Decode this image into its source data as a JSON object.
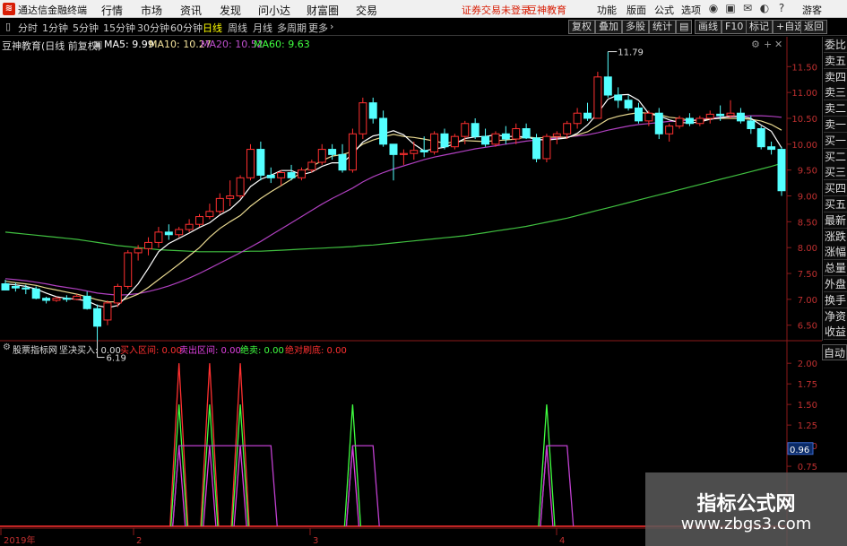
{
  "app": {
    "title": "通达信金融终端",
    "menus": [
      "行情",
      "市场",
      "资讯",
      "发现",
      "问小达",
      "财富圈",
      "交易"
    ],
    "notice": "证券交易未登录",
    "broker": "豆神教育",
    "right_menus": [
      "功能",
      "版面",
      "公式",
      "选项"
    ],
    "guest": "游客"
  },
  "toolbar": {
    "periods": [
      "分时",
      "1分钟",
      "5分钟",
      "15分钟",
      "30分钟",
      "60分钟",
      "日线",
      "周线",
      "月线",
      "多周期",
      "更多"
    ],
    "active_period": "日线",
    "right_buttons": [
      "复权",
      "叠加",
      "多股",
      "统计",
      "画线",
      "F10",
      "标记",
      "+自选",
      "返回"
    ]
  },
  "main_chart": {
    "label": "豆神教育(日线 前复权)",
    "ma": [
      {
        "label": "MA5: 9.99",
        "color": "#ffffff"
      },
      {
        "label": "MA10: 10.27",
        "color": "#f5e49c"
      },
      {
        "label": "MA20: 10.52",
        "color": "#c050d0"
      },
      {
        "label": "MA60: 9.63",
        "color": "#40ff40"
      }
    ],
    "high_label": "11.79",
    "low_label": "6.19"
  },
  "side_tabs": [
    "委比",
    "卖五",
    "卖四",
    "卖三",
    "卖二",
    "卖一",
    "买一",
    "买二",
    "买三",
    "买四",
    "买五",
    "最新",
    "涨跌",
    "涨幅",
    "总量",
    "外盘",
    "换手",
    "净资",
    "收益"
  ],
  "auto_tab": "自动",
  "indicator": {
    "name": "股票指标网",
    "items": [
      {
        "label": "坚决买入: 0.00",
        "color": "#dddddd"
      },
      {
        "label": "买入区间: 0.00",
        "color": "#ff3030"
      },
      {
        "label": "卖出区间: 0.00",
        "color": "#e040e0"
      },
      {
        "label": "绝卖: 0.00",
        "color": "#40ff40"
      },
      {
        "label": "绝对刷底: 0.00",
        "color": "#ff3030"
      }
    ],
    "current_value": "0.96"
  },
  "watermark": {
    "line1": "指标公式网",
    "line2": "www.zbgs3.com"
  },
  "chart_data": {
    "type": "candlestick",
    "y_ticks": [
      "11.50",
      "11.00",
      "10.50",
      "10.00",
      "9.50",
      "9.00",
      "8.50",
      "8.00",
      "7.50",
      "7.00",
      "6.50"
    ],
    "ylim": [
      6.2,
      11.8
    ],
    "indicator_ticks": [
      "2.00",
      "1.75",
      "1.50",
      "1.25",
      "1.00",
      "0.75"
    ],
    "x_labels": [
      "2019年",
      "2",
      "3",
      "4"
    ],
    "candles": [
      [
        7.3,
        7.38,
        7.2,
        7.18
      ],
      [
        7.25,
        7.32,
        7.15,
        7.22
      ],
      [
        7.22,
        7.28,
        7.1,
        7.2
      ],
      [
        7.2,
        7.25,
        7.0,
        7.02
      ],
      [
        7.02,
        7.05,
        6.92,
        6.98
      ],
      [
        6.98,
        7.05,
        6.95,
        7.02
      ],
      [
        7.02,
        7.08,
        6.95,
        7.0
      ],
      [
        7.0,
        7.1,
        6.98,
        7.06
      ],
      [
        7.06,
        7.15,
        6.8,
        6.82
      ],
      [
        6.82,
        6.9,
        6.19,
        6.48
      ],
      [
        6.6,
        6.98,
        6.5,
        6.93
      ],
      [
        6.93,
        7.3,
        6.85,
        7.25
      ],
      [
        7.25,
        7.95,
        7.2,
        7.9
      ],
      [
        7.9,
        8.05,
        7.75,
        7.98
      ],
      [
        7.98,
        8.2,
        7.85,
        8.1
      ],
      [
        8.1,
        8.4,
        8.0,
        8.3
      ],
      [
        8.3,
        8.45,
        8.15,
        8.25
      ],
      [
        8.25,
        8.4,
        8.2,
        8.35
      ],
      [
        8.35,
        8.55,
        8.3,
        8.45
      ],
      [
        8.45,
        8.65,
        8.4,
        8.6
      ],
      [
        8.6,
        8.85,
        8.55,
        8.7
      ],
      [
        8.7,
        9.05,
        8.65,
        8.95
      ],
      [
        8.95,
        9.3,
        8.8,
        9.0
      ],
      [
        9.0,
        9.4,
        8.95,
        9.35
      ],
      [
        9.35,
        10.0,
        9.3,
        9.9
      ],
      [
        9.9,
        10.05,
        9.3,
        9.4
      ],
      [
        9.4,
        9.55,
        9.25,
        9.35
      ],
      [
        9.35,
        9.5,
        9.2,
        9.45
      ],
      [
        9.45,
        9.6,
        9.3,
        9.35
      ],
      [
        9.35,
        9.55,
        9.3,
        9.5
      ],
      [
        9.5,
        9.7,
        9.45,
        9.65
      ],
      [
        9.65,
        10.0,
        9.6,
        9.9
      ],
      [
        9.9,
        10.0,
        9.7,
        9.8
      ],
      [
        9.8,
        10.0,
        9.45,
        9.5
      ],
      [
        9.5,
        10.3,
        9.45,
        10.2
      ],
      [
        10.2,
        10.9,
        10.1,
        10.8
      ],
      [
        10.8,
        10.9,
        10.4,
        10.5
      ],
      [
        10.5,
        10.65,
        9.95,
        10.0
      ],
      [
        10.0,
        10.0,
        9.3,
        9.8
      ],
      [
        9.8,
        9.9,
        9.6,
        9.82
      ],
      [
        9.82,
        10.05,
        9.7,
        9.88
      ],
      [
        9.88,
        10.15,
        9.75,
        9.85
      ],
      [
        9.85,
        10.25,
        9.8,
        10.2
      ],
      [
        10.2,
        10.3,
        9.9,
        9.95
      ],
      [
        9.95,
        10.2,
        9.9,
        10.15
      ],
      [
        10.15,
        10.45,
        10.0,
        10.4
      ],
      [
        10.4,
        10.5,
        10.1,
        10.15
      ],
      [
        10.15,
        10.3,
        9.95,
        10.0
      ],
      [
        10.0,
        10.25,
        9.95,
        10.2
      ],
      [
        10.2,
        10.35,
        10.0,
        10.1
      ],
      [
        10.1,
        10.4,
        10.0,
        10.3
      ],
      [
        10.3,
        10.4,
        10.1,
        10.12
      ],
      [
        10.12,
        10.2,
        9.65,
        9.72
      ],
      [
        9.72,
        10.2,
        9.65,
        10.15
      ],
      [
        10.15,
        10.25,
        10.0,
        10.2
      ],
      [
        10.2,
        10.45,
        10.1,
        10.4
      ],
      [
        10.4,
        10.7,
        10.3,
        10.6
      ],
      [
        10.6,
        10.8,
        10.45,
        10.5
      ],
      [
        10.5,
        11.4,
        10.5,
        11.3
      ],
      [
        11.3,
        11.79,
        10.9,
        10.95
      ],
      [
        10.95,
        11.1,
        10.7,
        10.85
      ],
      [
        10.85,
        10.95,
        10.65,
        10.7
      ],
      [
        10.7,
        10.8,
        10.4,
        10.45
      ],
      [
        10.45,
        10.65,
        10.35,
        10.6
      ],
      [
        10.6,
        10.7,
        10.1,
        10.2
      ],
      [
        10.2,
        10.4,
        10.05,
        10.35
      ],
      [
        10.35,
        10.55,
        10.3,
        10.5
      ],
      [
        10.5,
        10.6,
        10.35,
        10.4
      ],
      [
        10.4,
        10.55,
        10.35,
        10.5
      ],
      [
        10.5,
        10.65,
        10.4,
        10.58
      ],
      [
        10.58,
        10.75,
        10.45,
        10.55
      ],
      [
        10.55,
        10.85,
        10.5,
        10.6
      ],
      [
        10.6,
        10.7,
        10.4,
        10.45
      ],
      [
        10.45,
        10.55,
        10.2,
        10.3
      ],
      [
        10.3,
        10.35,
        9.9,
        9.95
      ],
      [
        9.95,
        10.05,
        9.8,
        9.9
      ],
      [
        9.9,
        9.95,
        9.0,
        9.1
      ]
    ],
    "ma5": [
      7.3,
      7.28,
      7.25,
      7.2,
      7.12,
      7.05,
      7.02,
      7.0,
      6.97,
      6.88,
      6.84,
      6.88,
      7.08,
      7.3,
      7.6,
      7.92,
      8.08,
      8.18,
      8.28,
      8.39,
      8.48,
      8.63,
      8.74,
      8.92,
      9.18,
      9.32,
      9.4,
      9.49,
      9.49,
      9.41,
      9.46,
      9.57,
      9.64,
      9.64,
      9.81,
      10.04,
      10.16,
      10.2,
      10.26,
      10.18,
      10.0,
      9.87,
      9.91,
      9.94,
      10.01,
      10.11,
      10.14,
      10.15,
      10.18,
      10.15,
      10.15,
      10.14,
      10.09,
      10.08,
      10.1,
      10.12,
      10.21,
      10.37,
      10.6,
      10.87,
      10.95,
      10.96,
      10.85,
      10.59,
      10.55,
      10.47,
      10.42,
      10.41,
      10.43,
      10.48,
      10.51,
      10.54,
      10.54,
      10.5,
      10.37,
      10.25,
      9.93
    ],
    "ma10": [
      7.35,
      7.32,
      7.3,
      7.27,
      7.22,
      7.18,
      7.14,
      7.1,
      7.05,
      6.99,
      6.95,
      6.95,
      7.02,
      7.1,
      7.23,
      7.38,
      7.53,
      7.68,
      7.84,
      8.0,
      8.2,
      8.37,
      8.5,
      8.62,
      8.8,
      8.95,
      9.08,
      9.2,
      9.32,
      9.46,
      9.57,
      9.68,
      9.77,
      9.8,
      9.86,
      10.0,
      10.08,
      10.14,
      10.19,
      10.15,
      10.13,
      10.1,
      10.06,
      10.02,
      10.04,
      10.07,
      10.06,
      10.05,
      10.07,
      10.08,
      10.1,
      10.14,
      10.12,
      10.13,
      10.14,
      10.13,
      10.18,
      10.24,
      10.36,
      10.48,
      10.54,
      10.58,
      10.61,
      10.6,
      10.57,
      10.52,
      10.5,
      10.46,
      10.46,
      10.49,
      10.5,
      10.5,
      10.5,
      10.48,
      10.45,
      10.38,
      10.27
    ],
    "ma20": [
      7.4,
      7.38,
      7.36,
      7.33,
      7.3,
      7.26,
      7.23,
      7.2,
      7.16,
      7.12,
      7.1,
      7.08,
      7.09,
      7.11,
      7.15,
      7.2,
      7.26,
      7.33,
      7.41,
      7.5,
      7.6,
      7.7,
      7.8,
      7.9,
      8.01,
      8.12,
      8.24,
      8.36,
      8.48,
      8.6,
      8.72,
      8.84,
      8.95,
      9.05,
      9.15,
      9.27,
      9.37,
      9.45,
      9.52,
      9.58,
      9.64,
      9.7,
      9.75,
      9.79,
      9.83,
      9.87,
      9.91,
      9.94,
      9.97,
      10.0,
      10.03,
      10.06,
      10.08,
      10.1,
      10.12,
      10.14,
      10.16,
      10.18,
      10.22,
      10.27,
      10.31,
      10.35,
      10.38,
      10.4,
      10.42,
      10.44,
      10.45,
      10.46,
      10.48,
      10.5,
      10.52,
      10.53,
      10.54,
      10.55,
      10.55,
      10.54,
      10.52
    ],
    "ma60": [
      8.3,
      8.28,
      8.26,
      8.24,
      8.22,
      8.2,
      8.18,
      8.16,
      8.13,
      8.1,
      8.07,
      8.04,
      8.02,
      8.0,
      7.98,
      7.96,
      7.95,
      7.94,
      7.93,
      7.92,
      7.92,
      7.92,
      7.92,
      7.92,
      7.93,
      7.93,
      7.94,
      7.95,
      7.96,
      7.97,
      7.98,
      7.99,
      8.0,
      8.01,
      8.02,
      8.04,
      8.05,
      8.07,
      8.09,
      8.11,
      8.13,
      8.15,
      8.17,
      8.19,
      8.21,
      8.23,
      8.26,
      8.29,
      8.32,
      8.35,
      8.38,
      8.41,
      8.45,
      8.49,
      8.53,
      8.57,
      8.62,
      8.67,
      8.72,
      8.77,
      8.82,
      8.87,
      8.92,
      8.97,
      9.02,
      9.07,
      9.12,
      9.17,
      9.22,
      9.27,
      9.32,
      9.37,
      9.42,
      9.47,
      9.52,
      9.57,
      9.63
    ],
    "indicator_series": [
      {
        "name": "买入区间",
        "color": "#ff3030",
        "peaks": [
          [
            17,
            2.0
          ],
          [
            20,
            2.0
          ],
          [
            23,
            2.0
          ]
        ]
      },
      {
        "name": "绝卖",
        "color": "#40ff40",
        "peaks": [
          [
            17,
            1.5
          ],
          [
            20,
            1.5
          ],
          [
            23,
            1.5
          ],
          [
            34,
            1.5
          ],
          [
            53,
            1.5
          ]
        ]
      },
      {
        "name": "卖出区间",
        "color": "#e040e0",
        "peaks": [
          [
            17,
            1.0
          ],
          [
            20,
            1.0
          ],
          [
            23,
            1.0
          ],
          [
            34,
            1.0
          ],
          [
            53,
            1.0
          ]
        ]
      }
    ]
  }
}
